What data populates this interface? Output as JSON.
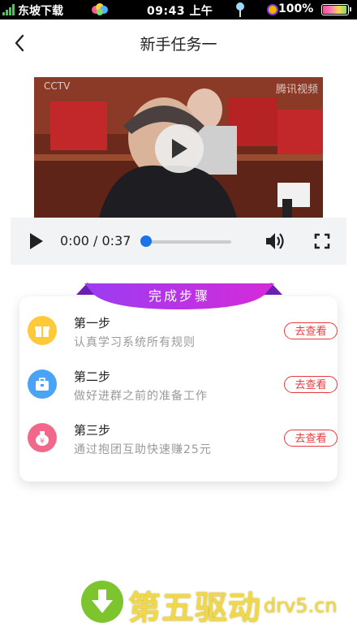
{
  "status_bar": {
    "carrier": "东坡下载",
    "time": "09:43 上午",
    "battery": "100%",
    "battery_level": 1.0
  },
  "header": {
    "back_icon": "chevron-left-icon",
    "title": "新手任务一"
  },
  "video": {
    "logo": "CCTV",
    "watermark": "腾讯视频",
    "play_icon": "play-icon"
  },
  "player_controls": {
    "time": "0:00 / 0:37",
    "progress": 0.0,
    "accent": "#1a73e8"
  },
  "steps_card": {
    "banner": "完成步骤",
    "banner_colors": [
      "#9b3cf2",
      "#d52bd8"
    ],
    "steps": [
      {
        "title": "第一步",
        "desc": "认真学习系统所有规则",
        "button": "去查看",
        "icon": "gift-icon",
        "icon_color": "#ffc93a"
      },
      {
        "title": "第二步",
        "desc": "做好进群之前的准备工作",
        "button": "去查看",
        "icon": "briefcase-icon",
        "icon_color": "#4aa3f5"
      },
      {
        "title": "第三步",
        "desc": "通过抱团互助快速赚25元",
        "button": "去查看",
        "icon": "money-bag-icon",
        "icon_color": "#f2688a"
      }
    ],
    "button_color": "#e8393e"
  },
  "watermark": {
    "text": "第五驱动",
    "domain": "drv5.cn"
  }
}
